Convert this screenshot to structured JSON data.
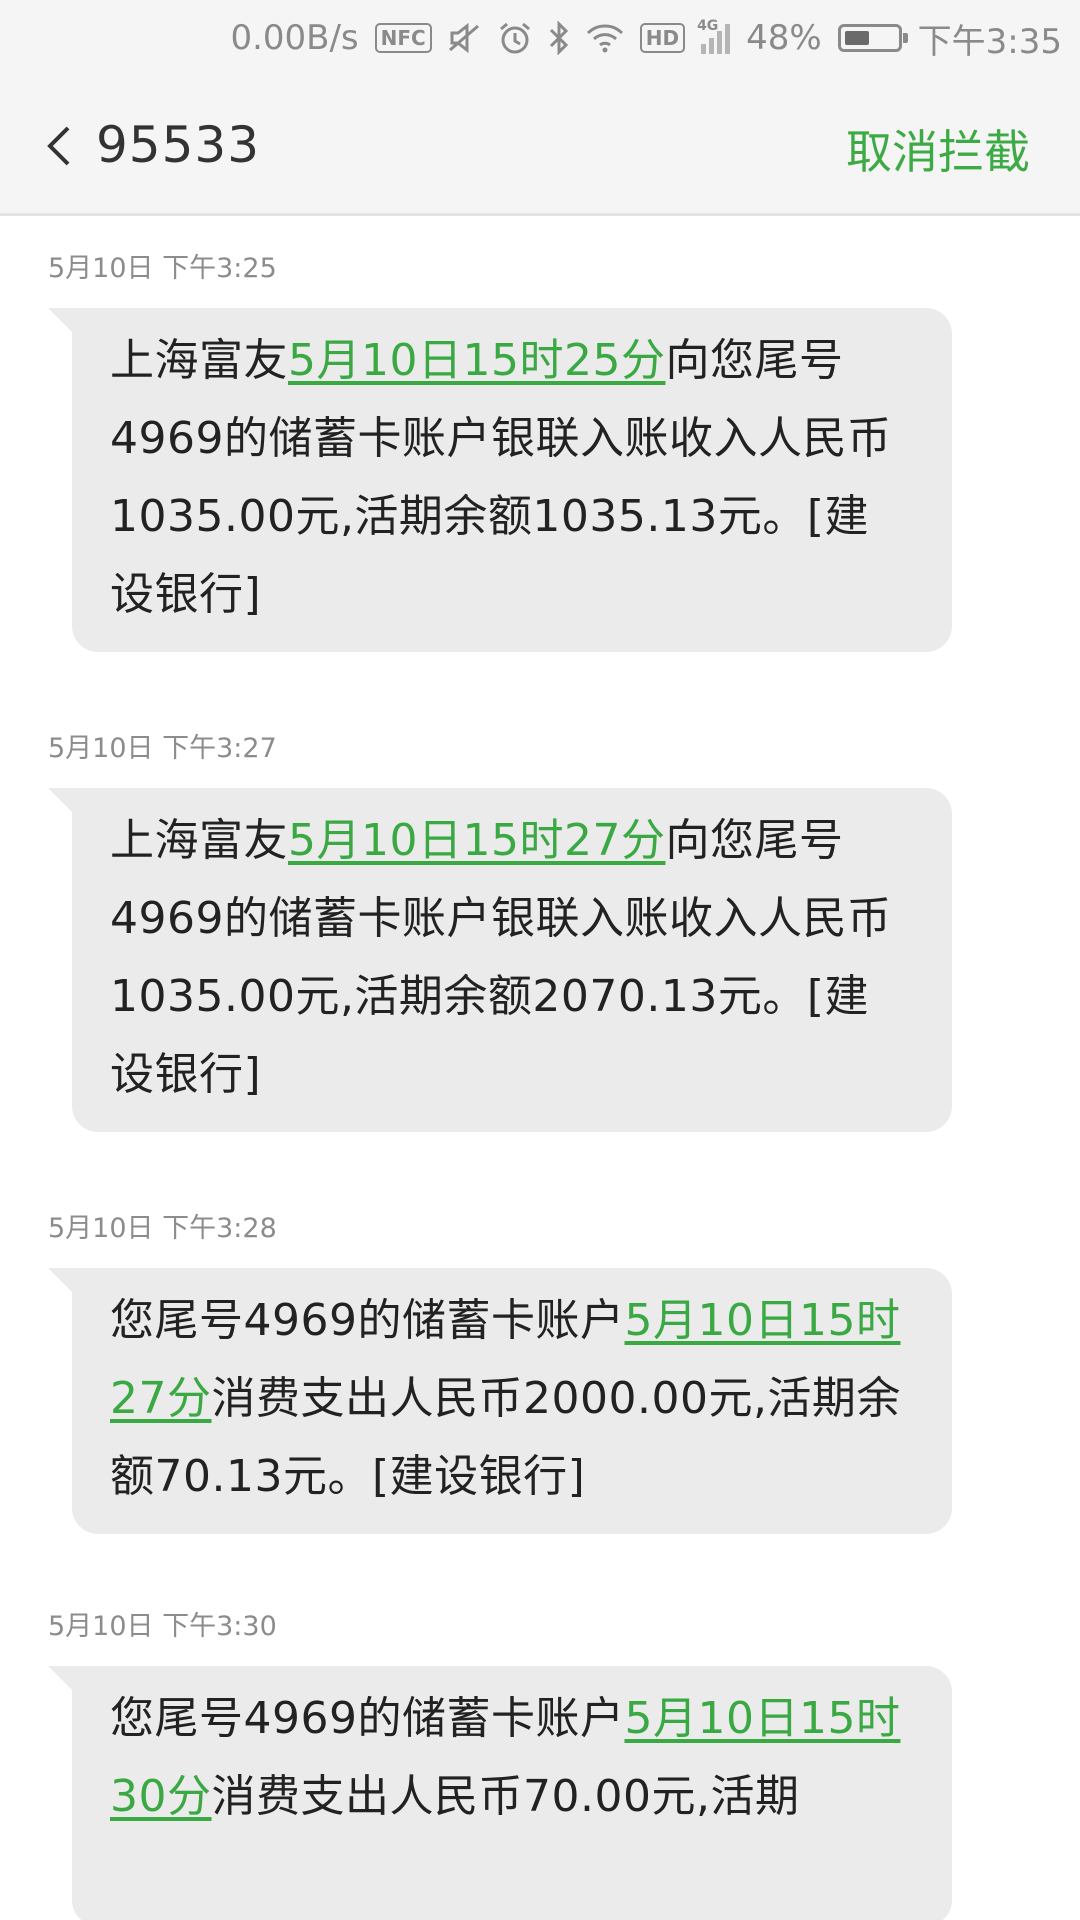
{
  "status_bar": {
    "net_speed": "0.00B/s",
    "nfc": "NFC",
    "hd": "HD",
    "network_type": "4G",
    "battery_percent": "48%",
    "battery_level": 0.48,
    "time": "下午3:35"
  },
  "header": {
    "title": "95533",
    "unblock_label": "取消拦截"
  },
  "messages": [
    {
      "timestamp": "5月10日 下午3:25",
      "pre": "上海富友",
      "link": "5月10日15时25分",
      "post": "向您尾号4969的储蓄卡账户银联入账收入人民币1035.00元,活期余额1035.13元。[建设银行]"
    },
    {
      "timestamp": "5月10日 下午3:27",
      "pre": "上海富友",
      "link": "5月10日15时27分",
      "post": "向您尾号4969的储蓄卡账户银联入账收入人民币1035.00元,活期余额2070.13元。[建设银行]"
    },
    {
      "timestamp": "5月10日 下午3:28",
      "pre": "您尾号4969的储蓄卡账户",
      "link": "5月10日15时27分",
      "post": "消费支出人民币2000.00元,活期余额70.13元。[建设银行]"
    },
    {
      "timestamp": "5月10日 下午3:30",
      "pre": "您尾号4969的储蓄卡账户",
      "link": "5月10日15时30分",
      "post": "消费支出人民币70.00元,活期"
    }
  ],
  "colors": {
    "accent": "#3eaa45",
    "bubble": "#ebebeb",
    "header_bg": "#f5f5f5"
  }
}
